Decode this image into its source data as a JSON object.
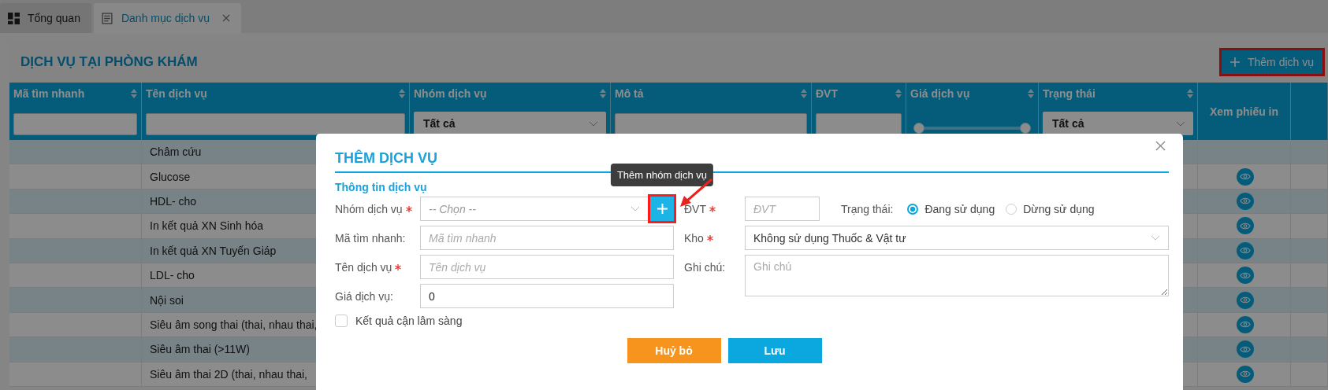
{
  "tabs": [
    {
      "label": "Tổng quan",
      "selected": false,
      "closable": false
    },
    {
      "label": "Danh mục dịch vụ",
      "selected": true,
      "closable": true
    }
  ],
  "page": {
    "title": "DỊCH VỤ TẠI PHÒNG KHÁM",
    "add_button": {
      "label": "Thêm dịch vụ",
      "highlighted": true
    }
  },
  "table": {
    "columns": [
      {
        "label": "Mã tìm nhanh",
        "sortable": true,
        "filter": {
          "kind": "text"
        }
      },
      {
        "label": "Tên dịch vụ",
        "sortable": true,
        "filter": {
          "kind": "text"
        }
      },
      {
        "label": "Nhóm dịch vụ",
        "sortable": true,
        "filter": {
          "kind": "select",
          "value": "Tất cả"
        }
      },
      {
        "label": "Mô tả",
        "sortable": true,
        "filter": {
          "kind": "text"
        }
      },
      {
        "label": "ĐVT",
        "sortable": true,
        "filter": {
          "kind": "text"
        }
      },
      {
        "label": "Giá dịch vụ",
        "sortable": true,
        "filter": {
          "kind": "range",
          "level": 1
        }
      },
      {
        "label": "Trạng thái",
        "sortable": true,
        "filter": {
          "kind": "select",
          "value": "Tất cả"
        }
      },
      {
        "label": "Xem phiếu in",
        "sortable": false,
        "filter": {
          "kind": "none"
        }
      }
    ],
    "rows": [
      {
        "name": "Châm cứu",
        "printable": false
      },
      {
        "name": "Glucose",
        "printable": true
      },
      {
        "name": "HDL- cho",
        "printable": true
      },
      {
        "name": "In kết quả XN Sinh hóa",
        "printable": true
      },
      {
        "name": "In kết quả XN Tuyến Giáp",
        "printable": true
      },
      {
        "name": "LDL- cho",
        "printable": true
      },
      {
        "name": "Nội soi",
        "printable": true
      },
      {
        "name": "Siêu âm song thai (thai, nhau thai,",
        "printable": true
      },
      {
        "name": "Siêu âm thai (>11W)",
        "printable": true
      },
      {
        "name": "Siêu âm thai 2D (thai, nhau thai,",
        "printable": true
      }
    ]
  },
  "dialog": {
    "title": "THÊM DỊCH VỤ",
    "section": "Thông tin dịch vụ",
    "left_fields": [
      {
        "kind": "select",
        "label": "Nhóm dịch vụ",
        "required": true,
        "placeholder": "-- Chọn --",
        "add_button": {
          "tooltip": "Thêm nhóm dịch vụ",
          "highlighted": true
        }
      },
      {
        "kind": "text",
        "label": "Mã tìm nhanh:",
        "required": false,
        "placeholder": "Mã tìm nhanh"
      },
      {
        "kind": "text",
        "label": "Tên dịch vụ",
        "required": true,
        "placeholder": "Tên dịch vụ"
      },
      {
        "kind": "text",
        "label": "Giá dịch vụ:",
        "required": false,
        "value": "0"
      }
    ],
    "checkbox": {
      "label": "Kết quả cận lâm sàng",
      "checked": false
    },
    "unit_field": {
      "label": "ĐVT",
      "required": true,
      "placeholder": "ĐVT"
    },
    "status": {
      "label": "Trạng thái:",
      "options": [
        {
          "label": "Đang sử dụng",
          "selected": true
        },
        {
          "label": "Dừng sử dụng",
          "selected": false
        }
      ]
    },
    "right_fields": [
      {
        "kind": "select",
        "label": "Kho",
        "required": true,
        "value": "Không sử dụng Thuốc & Vật tư"
      },
      {
        "kind": "textarea",
        "label": "Ghi chú:",
        "required": false,
        "placeholder": "Ghi chú"
      }
    ],
    "buttons": [
      {
        "label": "Huỷ bỏ",
        "kind": "cancel"
      },
      {
        "label": "Lưu",
        "kind": "save"
      }
    ]
  }
}
